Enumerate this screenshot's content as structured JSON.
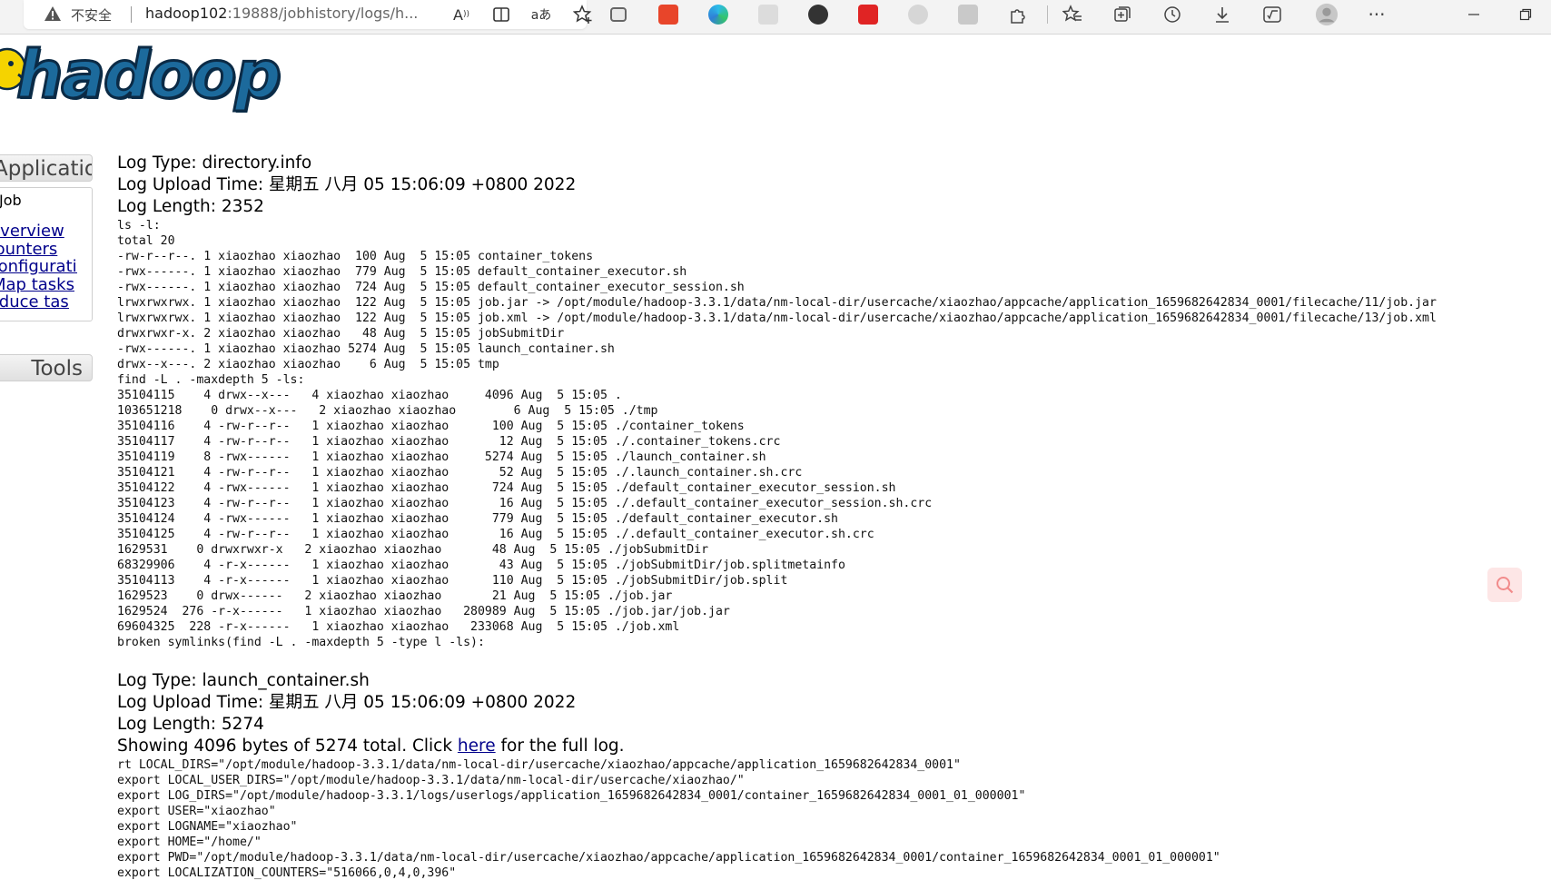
{
  "browser": {
    "security_label": "不安全",
    "url_host": "hadoop102",
    "url_rest": ":19888/jobhistory/logs/h...",
    "icons": [
      "read-aloud-icon",
      "immersive-reader-icon",
      "translate-icon",
      "add-favorite-icon",
      "extension-icons",
      "extensions-icon",
      "favorites-icon",
      "collections-icon",
      "history-icon",
      "downloads-icon",
      "math-solver-icon",
      "profile-icon",
      "more-icon",
      "minimize-icon",
      "restore-icon"
    ]
  },
  "logo": {
    "text": "hadoop"
  },
  "nav": {
    "application_header": "Application",
    "job_label": "Job",
    "links": [
      "Overview",
      "Counters",
      "Configuration",
      "Map tasks",
      "Reduce tasks"
    ],
    "tools_header": "Tools"
  },
  "log1": {
    "type": "Log Type: directory.info",
    "upload_time": "Log Upload Time: 星期五 八月 05 15:06:09 +0800 2022",
    "length": "Log Length: 2352",
    "body": "ls -l:\ntotal 20\n-rw-r--r--. 1 xiaozhao xiaozhao  100 Aug  5 15:05 container_tokens\n-rwx------. 1 xiaozhao xiaozhao  779 Aug  5 15:05 default_container_executor.sh\n-rwx------. 1 xiaozhao xiaozhao  724 Aug  5 15:05 default_container_executor_session.sh\nlrwxrwxrwx. 1 xiaozhao xiaozhao  122 Aug  5 15:05 job.jar -> /opt/module/hadoop-3.3.1/data/nm-local-dir/usercache/xiaozhao/appcache/application_1659682642834_0001/filecache/11/job.jar\nlrwxrwxrwx. 1 xiaozhao xiaozhao  122 Aug  5 15:05 job.xml -> /opt/module/hadoop-3.3.1/data/nm-local-dir/usercache/xiaozhao/appcache/application_1659682642834_0001/filecache/13/job.xml\ndrwxrwxr-x. 2 xiaozhao xiaozhao   48 Aug  5 15:05 jobSubmitDir\n-rwx------. 1 xiaozhao xiaozhao 5274 Aug  5 15:05 launch_container.sh\ndrwx--x---. 2 xiaozhao xiaozhao    6 Aug  5 15:05 tmp\nfind -L . -maxdepth 5 -ls:\n35104115    4 drwx--x---   4 xiaozhao xiaozhao     4096 Aug  5 15:05 .\n103651218    0 drwx--x---   2 xiaozhao xiaozhao        6 Aug  5 15:05 ./tmp\n35104116    4 -rw-r--r--   1 xiaozhao xiaozhao      100 Aug  5 15:05 ./container_tokens\n35104117    4 -rw-r--r--   1 xiaozhao xiaozhao       12 Aug  5 15:05 ./.container_tokens.crc\n35104119    8 -rwx------   1 xiaozhao xiaozhao     5274 Aug  5 15:05 ./launch_container.sh\n35104121    4 -rw-r--r--   1 xiaozhao xiaozhao       52 Aug  5 15:05 ./.launch_container.sh.crc\n35104122    4 -rwx------   1 xiaozhao xiaozhao      724 Aug  5 15:05 ./default_container_executor_session.sh\n35104123    4 -rw-r--r--   1 xiaozhao xiaozhao       16 Aug  5 15:05 ./.default_container_executor_session.sh.crc\n35104124    4 -rwx------   1 xiaozhao xiaozhao      779 Aug  5 15:05 ./default_container_executor.sh\n35104125    4 -rw-r--r--   1 xiaozhao xiaozhao       16 Aug  5 15:05 ./.default_container_executor.sh.crc\n1629531    0 drwxrwxr-x   2 xiaozhao xiaozhao       48 Aug  5 15:05 ./jobSubmitDir\n68329906    4 -r-x------   1 xiaozhao xiaozhao       43 Aug  5 15:05 ./jobSubmitDir/job.splitmetainfo\n35104113    4 -r-x------   1 xiaozhao xiaozhao      110 Aug  5 15:05 ./jobSubmitDir/job.split\n1629523    0 drwx------   2 xiaozhao xiaozhao       21 Aug  5 15:05 ./job.jar\n1629524  276 -r-x------   1 xiaozhao xiaozhao   280989 Aug  5 15:05 ./job.jar/job.jar\n69604325  228 -r-x------   1 xiaozhao xiaozhao   233068 Aug  5 15:05 ./job.xml\nbroken symlinks(find -L . -maxdepth 5 -type l -ls):"
  },
  "log2": {
    "type": "Log Type: launch_container.sh",
    "upload_time": "Log Upload Time: 星期五 八月 05 15:06:09 +0800 2022",
    "length": "Log Length: 5274",
    "showing_prefix": "Showing 4096 bytes of 5274 total. Click ",
    "here_link": "here",
    "showing_suffix": " for the full log.",
    "body": "rt LOCAL_DIRS=\"/opt/module/hadoop-3.3.1/data/nm-local-dir/usercache/xiaozhao/appcache/application_1659682642834_0001\"\nexport LOCAL_USER_DIRS=\"/opt/module/hadoop-3.3.1/data/nm-local-dir/usercache/xiaozhao/\"\nexport LOG_DIRS=\"/opt/module/hadoop-3.3.1/logs/userlogs/application_1659682642834_0001/container_1659682642834_0001_01_000001\"\nexport USER=\"xiaozhao\"\nexport LOGNAME=\"xiaozhao\"\nexport HOME=\"/home/\"\nexport PWD=\"/opt/module/hadoop-3.3.1/data/nm-local-dir/usercache/xiaozhao/appcache/application_1659682642834_0001/container_1659682642834_0001_01_000001\"\nexport LOCALIZATION_COUNTERS=\"516066,0,4,0,396\"\nexport JVM_PID=\"$$\""
  }
}
